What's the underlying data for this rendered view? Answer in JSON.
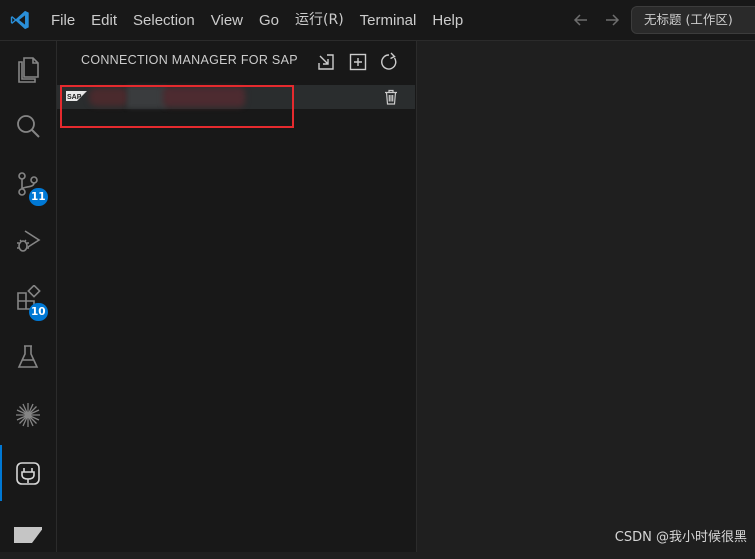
{
  "titlebar": {
    "menu": [
      "File",
      "Edit",
      "Selection",
      "View",
      "Go",
      "运行(R)",
      "Terminal",
      "Help"
    ],
    "command_center": "无标题 (工作区)"
  },
  "activitybar": {
    "items": [
      {
        "name": "explorer-icon"
      },
      {
        "name": "search-icon"
      },
      {
        "name": "source-control-icon",
        "badge": "11"
      },
      {
        "name": "run-debug-icon"
      },
      {
        "name": "extensions-icon",
        "badge": "10"
      },
      {
        "name": "testing-icon"
      },
      {
        "name": "sparkle-icon"
      },
      {
        "name": "connection-manager-icon",
        "active": true
      },
      {
        "name": "tag-icon"
      }
    ]
  },
  "sidebar": {
    "title": "CONNECTION MANAGER FOR SAP ...",
    "connection": {
      "logo_text": "SAP",
      "name": ""
    }
  },
  "watermark": "CSDN @我小时候很黑",
  "colors": {
    "accent": "#0078d4",
    "highlight_box": "#e52a2e",
    "sidebar_bg": "#181818",
    "editor_bg": "#1f1f1f"
  }
}
